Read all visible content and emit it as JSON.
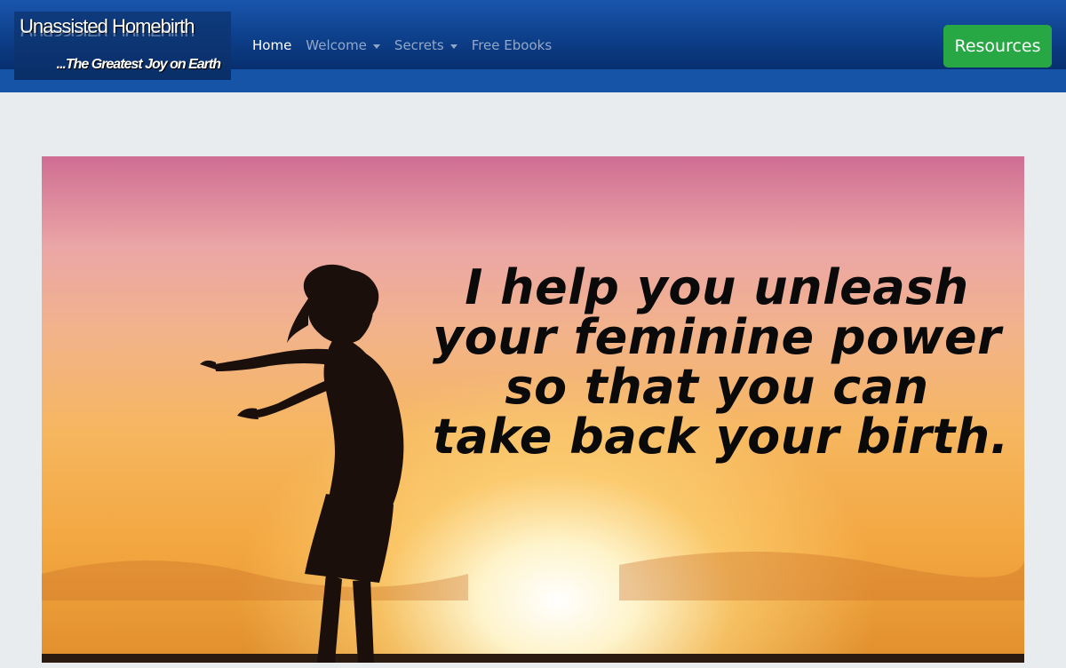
{
  "brand": {
    "title": "Unassisted Homebirth",
    "tagline": "...The Greatest Joy on Earth"
  },
  "nav": {
    "items": [
      {
        "label": "Home",
        "active": true,
        "dropdown": false
      },
      {
        "label": "Welcome",
        "active": false,
        "dropdown": true
      },
      {
        "label": "Secrets",
        "active": false,
        "dropdown": true
      },
      {
        "label": "Free Ebooks",
        "active": false,
        "dropdown": false
      }
    ]
  },
  "resources_button": {
    "label": "Resources"
  },
  "hero": {
    "lines": [
      "I help you unleash",
      "your feminine power",
      "so that you can",
      "take back your birth."
    ]
  },
  "colors": {
    "navbar": "#1654a8",
    "resources_button": "#28a745",
    "page_background": "#e9ecef"
  }
}
